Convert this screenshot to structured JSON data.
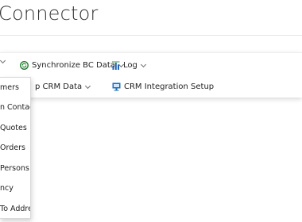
{
  "page": {
    "title": "Connector"
  },
  "action_bar": {
    "row1": {
      "truncated_menu_chevron": "",
      "synchronize": "Synchronize BC Data",
      "log": "Log"
    },
    "row2": {
      "map_crm": "p CRM Data",
      "setup": "CRM Integration Setup"
    }
  },
  "dropdown": {
    "items": [
      "mers",
      "n Contacts",
      "Quotes",
      "Orders",
      "Persons",
      "ncy",
      "To Address"
    ]
  },
  "colors": {
    "sync_icon": "#1f7a2e",
    "log_icon": "#1e63b8",
    "setup_icon": "#1b6fb5"
  },
  "icons": {
    "sync": "sync-circle-icon",
    "log": "bar-chart-icon",
    "setup": "monitor-icon"
  }
}
